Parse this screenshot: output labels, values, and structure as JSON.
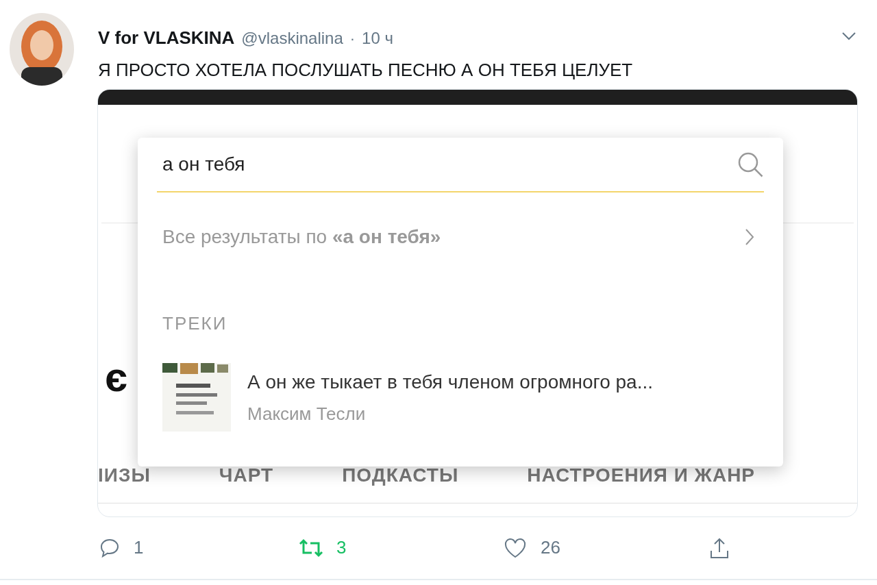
{
  "tweet": {
    "author": "V for VLASKINA",
    "handle": "@vlaskinalina",
    "separator": "·",
    "time": "10 ч",
    "text": "Я ПРОСТО ХОТЕЛА ПОСЛУШАТЬ ПЕСНЮ А ОН ТЕБЯ ЦЕЛУЕТ"
  },
  "embed": {
    "logo_letter": "є",
    "nav": [
      "ІИЗЫ",
      "ЧАРТ",
      "ПОДКАСТЫ",
      "НАСТРОЕНИЯ И ЖАНР"
    ],
    "search": {
      "value": "а он тебя",
      "all_results": "Все результаты по **«а он тебя»**",
      "section": "ТРЕКИ",
      "tracks": [
        {
          "kind": "picture",
          "title": "А он же тыкает в тебя членом огромного ра...",
          "artist": "Максим Тесли"
        }
      ]
    }
  },
  "actions": {
    "replies": "1",
    "retweets": "3",
    "retweeted": true,
    "likes": "26",
    "liked": false
  }
}
